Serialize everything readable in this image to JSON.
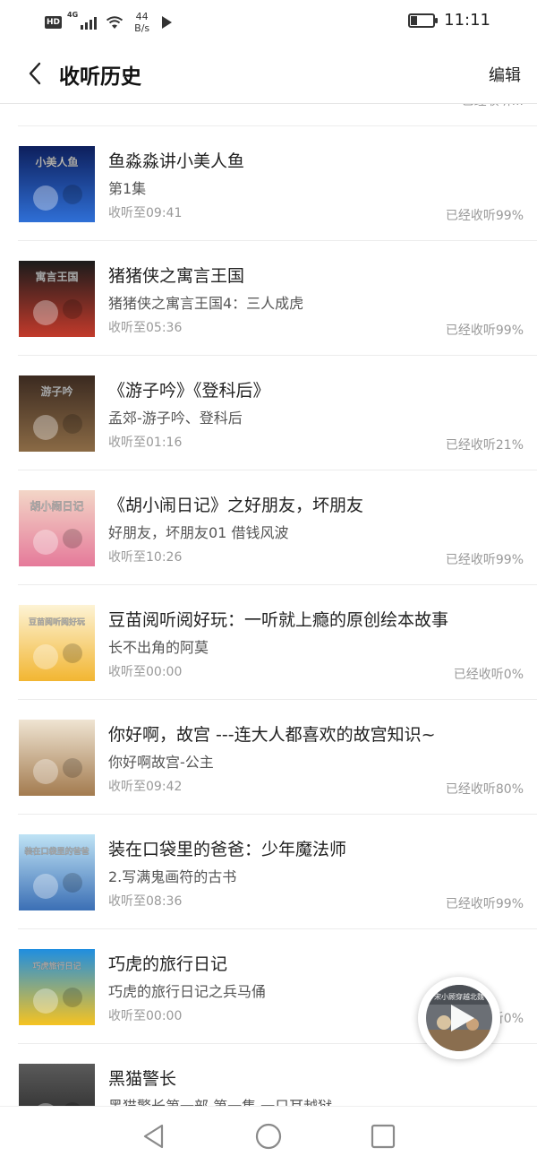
{
  "status_bar": {
    "hd": "HD",
    "network": "4G",
    "speed_value": "44",
    "speed_unit": "B/s",
    "time": "11:11",
    "battery_level": 0.3
  },
  "header": {
    "back_icon": "chevron-left-icon",
    "title": "收听历史",
    "edit_label": "编辑"
  },
  "items": [
    {
      "title": "",
      "subtitle": "",
      "time": "",
      "progress": "已经收听...",
      "partial": true
    },
    {
      "title": "鱼淼淼讲小美人鱼",
      "subtitle": "第1集",
      "time": "收听至09:41",
      "progress": "已经收听99%",
      "cover_text": "小美人鱼",
      "cover_colors": [
        "#0d1f5c",
        "#2f6fd6"
      ]
    },
    {
      "title": "猪猪侠之寓言王国",
      "subtitle": "猪猪侠之寓言王国4：三人成虎",
      "time": "收听至05:36",
      "progress": "已经收听99%",
      "cover_text": "寓言王国",
      "cover_colors": [
        "#1b1b1b",
        "#c23a2b"
      ]
    },
    {
      "title": "《游子吟》《登科后》",
      "subtitle": "孟郊-游子吟、登科后",
      "time": "收听至01:16",
      "progress": "已经收听21%",
      "cover_text": "游子吟",
      "cover_colors": [
        "#3b2a20",
        "#8a6a45"
      ]
    },
    {
      "title": "《胡小闹日记》之好朋友，坏朋友",
      "subtitle": "好朋友，坏朋友01 借钱风波",
      "time": "收听至10:26",
      "progress": "已经收听99%",
      "cover_text": "胡小闹日记",
      "cover_colors": [
        "#f3d6c7",
        "#e57a9a"
      ]
    },
    {
      "title": "豆苗阅听阅好玩：一听就上瘾的原创绘本故事",
      "subtitle": "长不出角的阿莫",
      "time": "收听至00:00",
      "progress": "已经收听0%",
      "cover_text": "豆苗阅听阅好玩",
      "cover_colors": [
        "#fdf3d5",
        "#f2b632"
      ]
    },
    {
      "title": "你好啊，故宫 ---连大人都喜欢的故宫知识~",
      "subtitle": "你好啊故宫-公主",
      "time": "收听至09:42",
      "progress": "已经收听80%",
      "cover_text": "",
      "cover_colors": [
        "#efe4d2",
        "#a37b4f"
      ]
    },
    {
      "title": "装在口袋里的爸爸：少年魔法师",
      "subtitle": "2.写满鬼画符的古书",
      "time": "收听至08:36",
      "progress": "已经收听99%",
      "cover_text": "装在口袋里的爸爸",
      "cover_colors": [
        "#bfe3f5",
        "#3b6fb5"
      ]
    },
    {
      "title": "巧虎的旅行日记",
      "subtitle": "巧虎的旅行日记之兵马俑",
      "time": "收听至00:00",
      "progress": "已经收听0%",
      "cover_text": "巧虎旅行日记",
      "cover_colors": [
        "#1f8ee0",
        "#f6c321"
      ]
    },
    {
      "title": "黑猫警长",
      "subtitle": "黑猫警长第一部 第一集 一只耳越狱",
      "time": "",
      "progress": "",
      "cover_text": "",
      "cover_colors": [
        "#5a5a5a",
        "#1f1f1f"
      ]
    }
  ],
  "floating_player": {
    "icon": "play-icon",
    "cover_text": "宋小顾穿越北魏"
  },
  "nav": {
    "back_icon": "triangle-back-icon",
    "home_icon": "circle-home-icon",
    "recent_icon": "square-recent-icon"
  }
}
